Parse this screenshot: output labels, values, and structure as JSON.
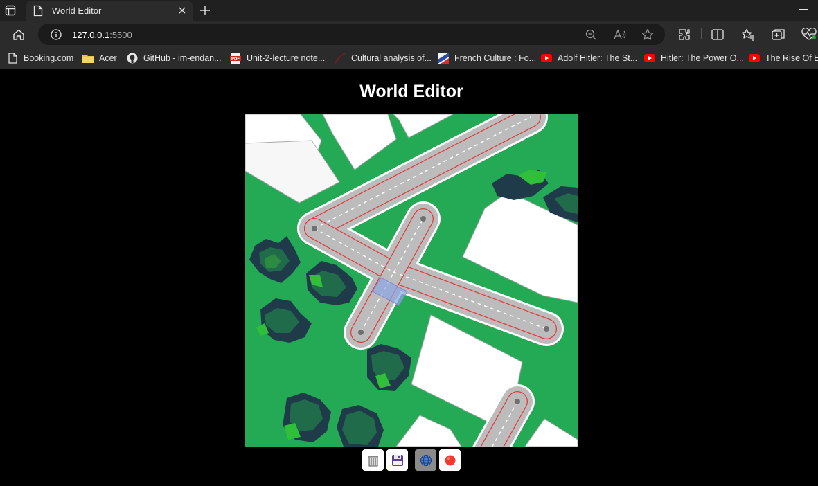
{
  "browser": {
    "tab_title": "World Editor",
    "url_host": "127.0.0.1",
    "url_port": ":5500"
  },
  "bookmarks": [
    {
      "label": "Booking.com",
      "icon": "page-icon"
    },
    {
      "label": "Acer",
      "icon": "folder-icon"
    },
    {
      "label": "GitHub - im-endan...",
      "icon": "github-icon"
    },
    {
      "label": "Unit-2-lecture note...",
      "icon": "pdf-icon"
    },
    {
      "label": "Cultural analysis of...",
      "icon": "site-icon"
    },
    {
      "label": "French Culture : Fo...",
      "icon": "site-icon"
    },
    {
      "label": "Adolf Hitler: The St...",
      "icon": "youtube-icon"
    },
    {
      "label": "Hitler: The Power O...",
      "icon": "youtube-icon"
    },
    {
      "label": "The Rise Of Em",
      "icon": "youtube-icon"
    }
  ],
  "page": {
    "title": "World Editor"
  },
  "controls": [
    {
      "name": "dispose-button",
      "glyph": "🗑"
    },
    {
      "name": "save-button",
      "glyph": "💾"
    },
    {
      "name": "graph-editor-button",
      "glyph": "🌐"
    },
    {
      "name": "stop-marking-button",
      "glyph": "🔴"
    }
  ],
  "colors": {
    "grass": "#24a954",
    "road": "#bcbcbc",
    "road_border": "#ffffff",
    "lane_line": "#e23a3a",
    "building": "#ffffff",
    "tree_dark": "#1f3b4a",
    "tree_light": "#2fbf3a"
  }
}
